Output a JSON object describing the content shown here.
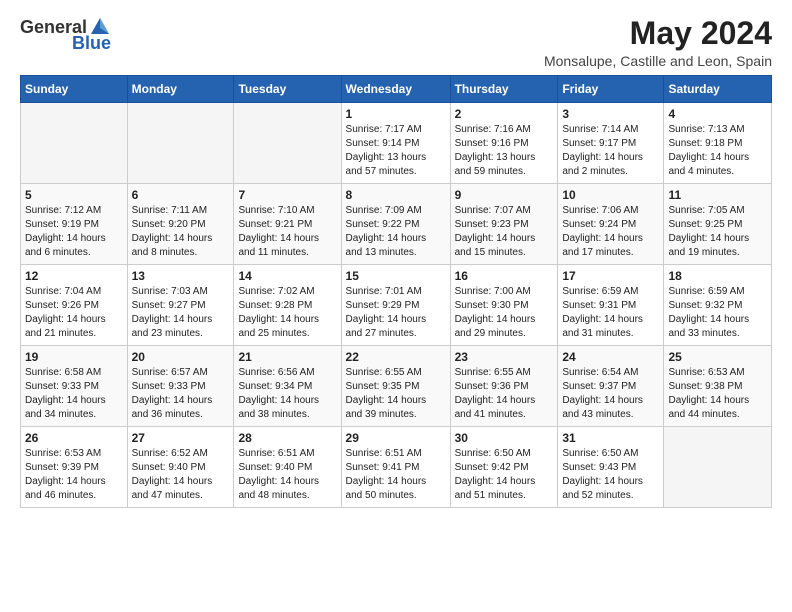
{
  "header": {
    "logo_general": "General",
    "logo_blue": "Blue",
    "title": "May 2024",
    "subtitle": "Monsalupe, Castille and Leon, Spain"
  },
  "days_of_week": [
    "Sunday",
    "Monday",
    "Tuesday",
    "Wednesday",
    "Thursday",
    "Friday",
    "Saturday"
  ],
  "weeks": [
    [
      {
        "day": "",
        "info": ""
      },
      {
        "day": "",
        "info": ""
      },
      {
        "day": "",
        "info": ""
      },
      {
        "day": "1",
        "info": "Sunrise: 7:17 AM\nSunset: 9:14 PM\nDaylight: 13 hours and 57 minutes."
      },
      {
        "day": "2",
        "info": "Sunrise: 7:16 AM\nSunset: 9:16 PM\nDaylight: 13 hours and 59 minutes."
      },
      {
        "day": "3",
        "info": "Sunrise: 7:14 AM\nSunset: 9:17 PM\nDaylight: 14 hours and 2 minutes."
      },
      {
        "day": "4",
        "info": "Sunrise: 7:13 AM\nSunset: 9:18 PM\nDaylight: 14 hours and 4 minutes."
      }
    ],
    [
      {
        "day": "5",
        "info": "Sunrise: 7:12 AM\nSunset: 9:19 PM\nDaylight: 14 hours and 6 minutes."
      },
      {
        "day": "6",
        "info": "Sunrise: 7:11 AM\nSunset: 9:20 PM\nDaylight: 14 hours and 8 minutes."
      },
      {
        "day": "7",
        "info": "Sunrise: 7:10 AM\nSunset: 9:21 PM\nDaylight: 14 hours and 11 minutes."
      },
      {
        "day": "8",
        "info": "Sunrise: 7:09 AM\nSunset: 9:22 PM\nDaylight: 14 hours and 13 minutes."
      },
      {
        "day": "9",
        "info": "Sunrise: 7:07 AM\nSunset: 9:23 PM\nDaylight: 14 hours and 15 minutes."
      },
      {
        "day": "10",
        "info": "Sunrise: 7:06 AM\nSunset: 9:24 PM\nDaylight: 14 hours and 17 minutes."
      },
      {
        "day": "11",
        "info": "Sunrise: 7:05 AM\nSunset: 9:25 PM\nDaylight: 14 hours and 19 minutes."
      }
    ],
    [
      {
        "day": "12",
        "info": "Sunrise: 7:04 AM\nSunset: 9:26 PM\nDaylight: 14 hours and 21 minutes."
      },
      {
        "day": "13",
        "info": "Sunrise: 7:03 AM\nSunset: 9:27 PM\nDaylight: 14 hours and 23 minutes."
      },
      {
        "day": "14",
        "info": "Sunrise: 7:02 AM\nSunset: 9:28 PM\nDaylight: 14 hours and 25 minutes."
      },
      {
        "day": "15",
        "info": "Sunrise: 7:01 AM\nSunset: 9:29 PM\nDaylight: 14 hours and 27 minutes."
      },
      {
        "day": "16",
        "info": "Sunrise: 7:00 AM\nSunset: 9:30 PM\nDaylight: 14 hours and 29 minutes."
      },
      {
        "day": "17",
        "info": "Sunrise: 6:59 AM\nSunset: 9:31 PM\nDaylight: 14 hours and 31 minutes."
      },
      {
        "day": "18",
        "info": "Sunrise: 6:59 AM\nSunset: 9:32 PM\nDaylight: 14 hours and 33 minutes."
      }
    ],
    [
      {
        "day": "19",
        "info": "Sunrise: 6:58 AM\nSunset: 9:33 PM\nDaylight: 14 hours and 34 minutes."
      },
      {
        "day": "20",
        "info": "Sunrise: 6:57 AM\nSunset: 9:33 PM\nDaylight: 14 hours and 36 minutes."
      },
      {
        "day": "21",
        "info": "Sunrise: 6:56 AM\nSunset: 9:34 PM\nDaylight: 14 hours and 38 minutes."
      },
      {
        "day": "22",
        "info": "Sunrise: 6:55 AM\nSunset: 9:35 PM\nDaylight: 14 hours and 39 minutes."
      },
      {
        "day": "23",
        "info": "Sunrise: 6:55 AM\nSunset: 9:36 PM\nDaylight: 14 hours and 41 minutes."
      },
      {
        "day": "24",
        "info": "Sunrise: 6:54 AM\nSunset: 9:37 PM\nDaylight: 14 hours and 43 minutes."
      },
      {
        "day": "25",
        "info": "Sunrise: 6:53 AM\nSunset: 9:38 PM\nDaylight: 14 hours and 44 minutes."
      }
    ],
    [
      {
        "day": "26",
        "info": "Sunrise: 6:53 AM\nSunset: 9:39 PM\nDaylight: 14 hours and 46 minutes."
      },
      {
        "day": "27",
        "info": "Sunrise: 6:52 AM\nSunset: 9:40 PM\nDaylight: 14 hours and 47 minutes."
      },
      {
        "day": "28",
        "info": "Sunrise: 6:51 AM\nSunset: 9:40 PM\nDaylight: 14 hours and 48 minutes."
      },
      {
        "day": "29",
        "info": "Sunrise: 6:51 AM\nSunset: 9:41 PM\nDaylight: 14 hours and 50 minutes."
      },
      {
        "day": "30",
        "info": "Sunrise: 6:50 AM\nSunset: 9:42 PM\nDaylight: 14 hours and 51 minutes."
      },
      {
        "day": "31",
        "info": "Sunrise: 6:50 AM\nSunset: 9:43 PM\nDaylight: 14 hours and 52 minutes."
      },
      {
        "day": "",
        "info": ""
      }
    ]
  ]
}
